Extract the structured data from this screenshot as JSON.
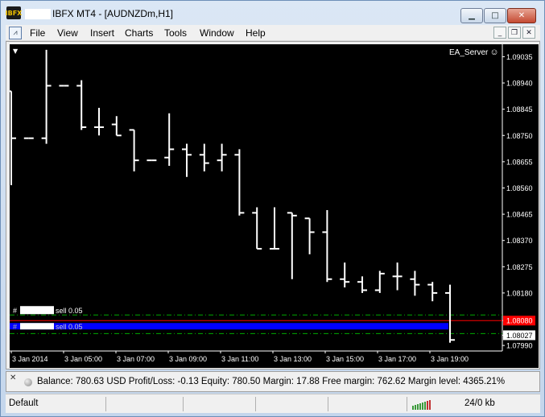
{
  "window": {
    "app_icon": "IBFX",
    "title": "IBFX MT4 - [AUDNZDm,H1]",
    "controls": {
      "minimize_icon": "minimize-icon",
      "maximize_icon": "maximize-icon",
      "close_icon": "close-icon"
    }
  },
  "menu": {
    "items": [
      "File",
      "View",
      "Insert",
      "Charts",
      "Tools",
      "Window",
      "Help"
    ]
  },
  "chart": {
    "ea_label": "EA_Server",
    "smiley": "☺",
    "colors": {
      "background": "#000000",
      "bars": "#ffffff",
      "current_price_bg": "#ffffff",
      "order_line_bg": "#ff0000",
      "highlight_band": "#0000ff",
      "level_lines": "#00aa00"
    },
    "order_label_1": "sell 0.05",
    "order_label_2": "sell 0.05"
  },
  "chart_data": {
    "type": "bar",
    "symbol": "AUDNZDm",
    "timeframe": "H1",
    "price_axis_labels": [
      "1.09035",
      "1.08940",
      "1.08845",
      "1.08750",
      "1.08655",
      "1.08560",
      "1.08465",
      "1.08370",
      "1.08275",
      "1.08180",
      "1.08080",
      "1.08027",
      "1.07990"
    ],
    "time_axis_labels": [
      "3 Jan 2014",
      "3 Jan 05:00",
      "3 Jan 07:00",
      "3 Jan 09:00",
      "3 Jan 11:00",
      "3 Jan 13:00",
      "3 Jan 15:00",
      "3 Jan 17:00",
      "3 Jan 19:00"
    ],
    "ylim": [
      1.0797,
      1.0908
    ],
    "current_price": 1.08027,
    "order_price": 1.0808,
    "ohlc": [
      {
        "o": 1.0891,
        "h": 1.0891,
        "l": 1.0857,
        "c": 1.0874
      },
      {
        "o": 1.0874,
        "h": 1.0874,
        "l": 1.0874,
        "c": 1.0874
      },
      {
        "o": 1.0874,
        "h": 1.0906,
        "l": 1.0872,
        "c": 1.0893
      },
      {
        "o": 1.0893,
        "h": 1.0893,
        "l": 1.0893,
        "c": 1.0893
      },
      {
        "o": 1.0893,
        "h": 1.0895,
        "l": 1.0877,
        "c": 1.0878
      },
      {
        "o": 1.0878,
        "h": 1.0885,
        "l": 1.0875,
        "c": 1.0878
      },
      {
        "o": 1.0879,
        "h": 1.0882,
        "l": 1.0875,
        "c": 1.0875
      },
      {
        "o": 1.0877,
        "h": 1.0877,
        "l": 1.0862,
        "c": 1.0866
      },
      {
        "o": 1.0866,
        "h": 1.0866,
        "l": 1.0866,
        "c": 1.0866
      },
      {
        "o": 1.0867,
        "h": 1.0883,
        "l": 1.0864,
        "c": 1.087
      },
      {
        "o": 1.087,
        "h": 1.0872,
        "l": 1.086,
        "c": 1.0868
      },
      {
        "o": 1.0868,
        "h": 1.0872,
        "l": 1.0862,
        "c": 1.0865
      },
      {
        "o": 1.0866,
        "h": 1.0872,
        "l": 1.0862,
        "c": 1.0868
      },
      {
        "o": 1.0868,
        "h": 1.087,
        "l": 1.0846,
        "c": 1.0847
      },
      {
        "o": 1.0847,
        "h": 1.0849,
        "l": 1.0834,
        "c": 1.0834
      },
      {
        "o": 1.0834,
        "h": 1.0849,
        "l": 1.0834,
        "c": 1.0834
      },
      {
        "o": 1.0847,
        "h": 1.0847,
        "l": 1.0823,
        "c": 1.0846
      },
      {
        "o": 1.0845,
        "h": 1.0845,
        "l": 1.0832,
        "c": 1.084
      },
      {
        "o": 1.084,
        "h": 1.0848,
        "l": 1.0822,
        "c": 1.0823
      },
      {
        "o": 1.0823,
        "h": 1.0829,
        "l": 1.082,
        "c": 1.0822
      },
      {
        "o": 1.0822,
        "h": 1.0824,
        "l": 1.0818,
        "c": 1.0819
      },
      {
        "o": 1.0819,
        "h": 1.0826,
        "l": 1.0818,
        "c": 1.0825
      },
      {
        "o": 1.0824,
        "h": 1.0829,
        "l": 1.0819,
        "c": 1.0824
      },
      {
        "o": 1.0823,
        "h": 1.0826,
        "l": 1.0817,
        "c": 1.0821
      },
      {
        "o": 1.0821,
        "h": 1.0822,
        "l": 1.0815,
        "c": 1.0818
      },
      {
        "o": 1.0818,
        "h": 1.0821,
        "l": 1.08,
        "c": 1.0801
      }
    ]
  },
  "terminal": {
    "close_icon": "close-icon",
    "summary": "Balance: 780.63 USD  Profit/Loss: -0.13  Equity: 780.50  Margin: 17.88  Free margin: 762.62  Margin level: 4365.21%"
  },
  "status": {
    "profile": "Default",
    "traffic": "24/0 kb"
  }
}
